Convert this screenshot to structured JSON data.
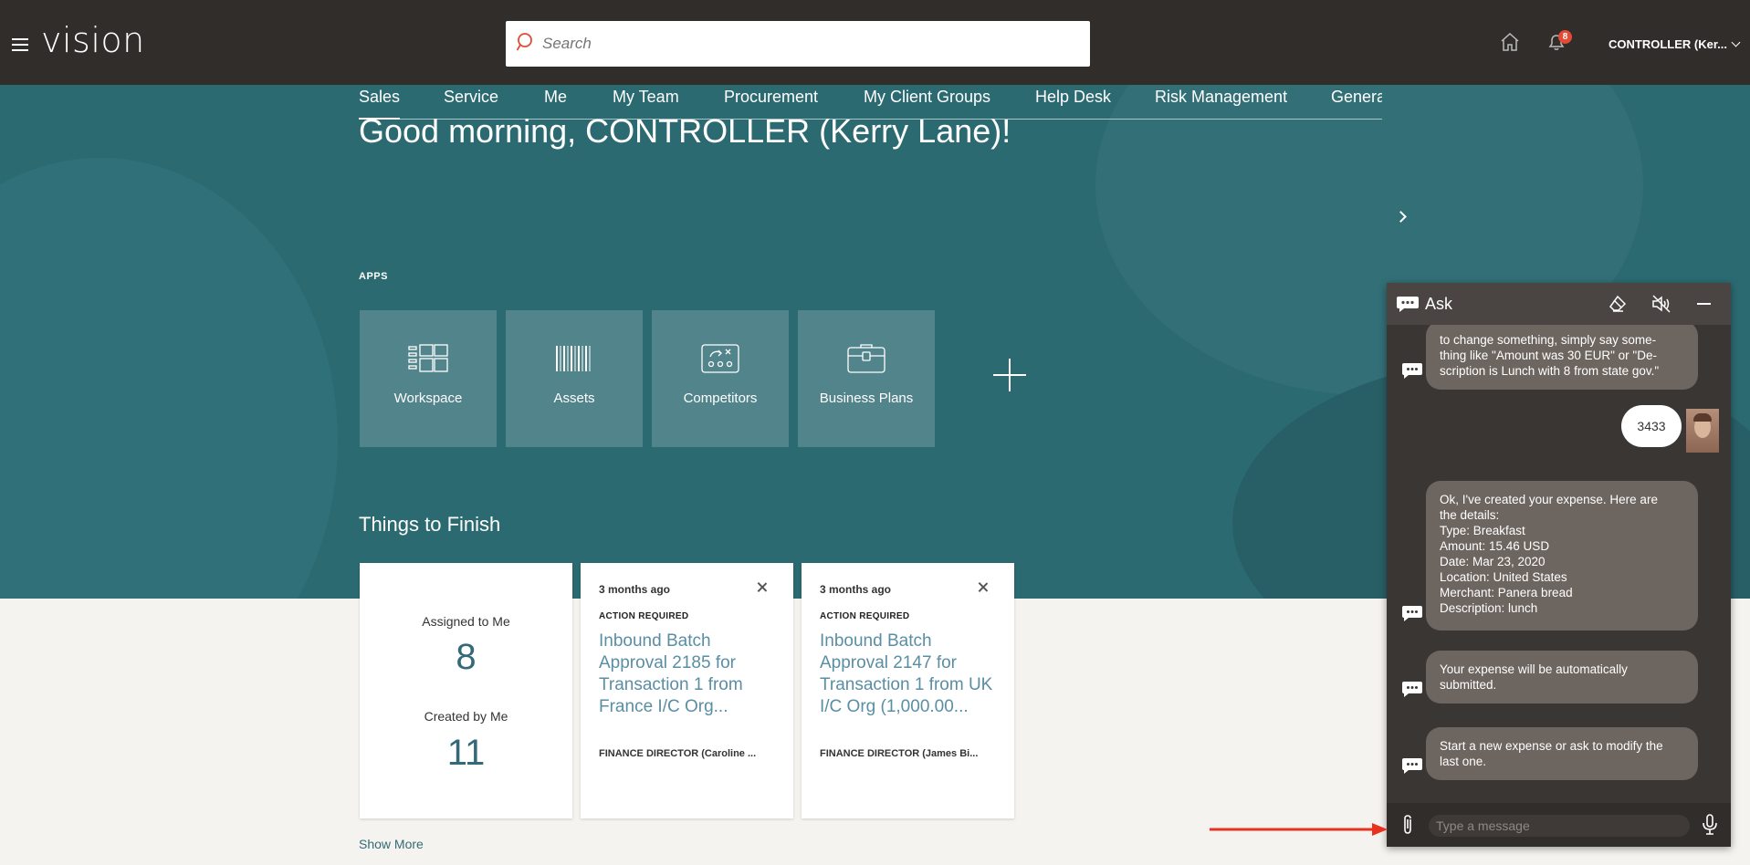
{
  "header": {
    "app_name": "vision",
    "search_placeholder": "Search",
    "notification_count": "8",
    "user_label": "CONTROLLER (Ker..."
  },
  "hero": {
    "greeting": "Good morning, CONTROLLER (Kerry Lane)!",
    "tabs": [
      "Sales",
      "Service",
      "Me",
      "My Team",
      "Procurement",
      "My Client Groups",
      "Help Desk",
      "Risk Management",
      "Genera"
    ],
    "active_tab": "Sales",
    "apps_label": "APPS",
    "apps": [
      "Workspace",
      "Assets",
      "Competitors",
      "Business Plans"
    ]
  },
  "things_to_finish": {
    "title": "Things to Finish",
    "summary": {
      "assigned_label": "Assigned to Me",
      "assigned_count": "8",
      "created_label": "Created by Me",
      "created_count": "11"
    },
    "tasks": [
      {
        "time": "3 months ago",
        "status": "ACTION REQUIRED",
        "title": "Inbound Batch Approval 2185 for Transaction 1 from France I/C Org...",
        "from": "FINANCE DIRECTOR (Caroline ..."
      },
      {
        "time": "3 months ago",
        "status": "ACTION REQUIRED",
        "title": "Inbound Batch Approval 2147 for Transaction 1 from UK I/C Org (1,000.00...",
        "from": "FINANCE DIRECTOR (James Bi..."
      }
    ],
    "show_more": "Show More"
  },
  "chat": {
    "title": "Ask",
    "messages": {
      "bot_1": "to change something, simply say some-\nthing like \"Amount was 30 EUR\" or \"De-\nscription is Lunch with 8 from state gov.\"",
      "user_1": "3433",
      "bot_2": "Ok, I've created your expense. Here are\nthe details:\nType: Breakfast\nAmount: 15.46 USD\nDate: Mar 23, 2020\nLocation: United States\nMerchant: Panera bread\nDescription: lunch",
      "bot_3": "Your expense will be automatically\nsubmitted.",
      "bot_4": "Start a new expense or ask to modify the\nlast one."
    },
    "input_placeholder": "Type a message"
  },
  "colors": {
    "header_bg": "#312d2a",
    "hero_bg": "#2c6a72",
    "accent_link": "#346a77",
    "chat_bubble": "#6d6560",
    "annotation_arrow": "#e8321f"
  }
}
